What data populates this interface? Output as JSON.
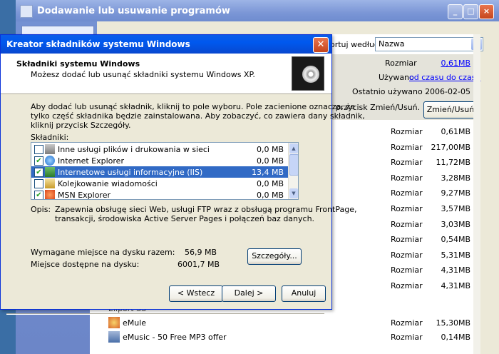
{
  "bg_window": {
    "title": "Dodawanie lub usuwanie programów",
    "sort_label": "Sortuj według:",
    "sort_value": "Nazwa",
    "selected_item": {
      "size_label": "Rozmiar",
      "size_value": "0,61MB",
      "used_label": "Używano",
      "used_value": "od czasu do czasu",
      "last_used_label": "Ostatnio używano",
      "last_used_value": "2006-02-05",
      "change_text": "lij przycisk Zmień/Usuń.",
      "change_button": "Zmień/Usuń"
    },
    "rows": [
      {
        "label": "Rozmiar",
        "value": "0,61MB"
      },
      {
        "label": "Rozmiar",
        "value": "217,00MB"
      },
      {
        "label": "Rozmiar",
        "value": "11,72MB"
      },
      {
        "label": "Rozmiar",
        "value": "3,28MB"
      },
      {
        "label": "Rozmiar",
        "value": "9,27MB"
      },
      {
        "label": "Rozmiar",
        "value": "3,57MB"
      },
      {
        "label": "Rozmiar",
        "value": "3,03MB"
      },
      {
        "label": "Rozmiar",
        "value": "0,54MB"
      },
      {
        "label": "Rozmiar",
        "value": "5,31MB"
      },
      {
        "label": "Rozmiar",
        "value": "4,31MB"
      },
      {
        "label": "Rozmiar",
        "value": "4,31MB"
      }
    ],
    "partial_row": "Ellport SS",
    "named_rows": [
      {
        "name": "eMule",
        "label": "Rozmiar",
        "value": "15,30MB"
      },
      {
        "name": "eMusic - 50 Free MP3 offer",
        "label": "Rozmiar",
        "value": "0,14MB"
      }
    ]
  },
  "dialog": {
    "title": "Kreator składników systemu Windows",
    "header_title": "Składniki systemu Windows",
    "header_sub": "Możesz dodać lub usunąć składniki systemu Windows XP.",
    "instructions": [
      "Aby dodać lub usunąć składnik, kliknij to pole wyboru. Pole zacienione oznacza, że",
      "tylko część składnika będzie zainstalowana. Aby zobaczyć, co zawiera dany składnik,",
      "kliknij przycisk Szczegóły."
    ],
    "components_label": "Składniki:",
    "components": [
      {
        "name": "Inne usługi plików i drukowania w sieci",
        "size": "0,0 MB",
        "checked": false
      },
      {
        "name": "Internet Explorer",
        "size": "0,0 MB",
        "checked": true
      },
      {
        "name": "Internetowe usługi informacyjne (IIS)",
        "size": "13,4 MB",
        "checked": true
      },
      {
        "name": "Kolejkowanie wiadomości",
        "size": "0,0 MB",
        "checked": false
      },
      {
        "name": "MSN Explorer",
        "size": "0,0 MB",
        "checked": true
      }
    ],
    "desc_label": "Opis:",
    "desc_lines": [
      "Zapewnia obsługę sieci Web, usługi FTP wraz z obsługą programu FrontPage,",
      "transakcji, środowiska Active Server Pages i połączeń baz danych."
    ],
    "required_label": "Wymagane miejsce na dysku razem:",
    "required_value": "56,9 MB",
    "available_label": "Miejsce dostępne na dysku:",
    "available_value": "6001,7 MB",
    "details_button": "Szczegóły...",
    "back_button": "< Wstecz",
    "next_button": "Dalej >",
    "cancel_button": "Anuluj"
  }
}
